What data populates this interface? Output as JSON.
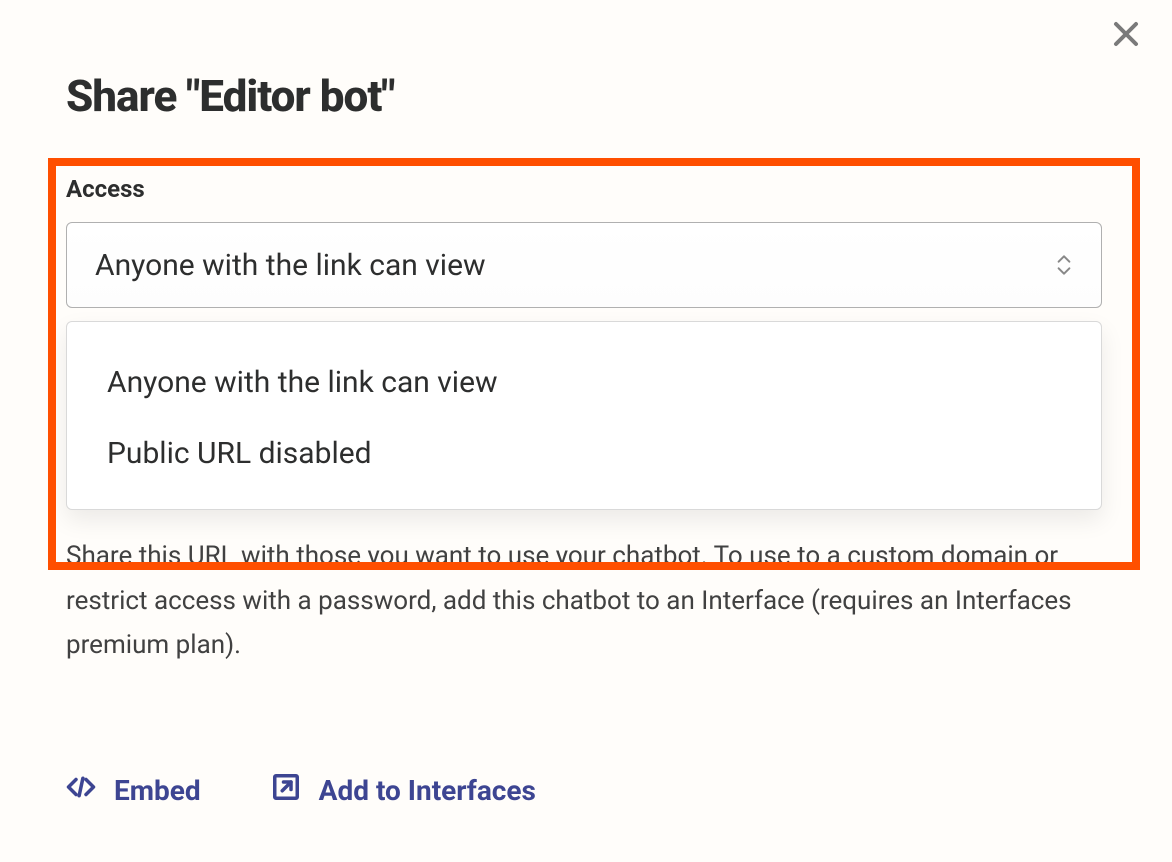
{
  "dialog": {
    "title": "Share \"Editor bot\""
  },
  "access": {
    "label": "Access",
    "selected": "Anyone with the link can view",
    "options": [
      "Anyone with the link can view",
      "Public URL disabled"
    ]
  },
  "help_text": "Share this URL with those you want to use your chatbot. To use to a custom domain or restrict access with a password, add this chatbot to an Interface (requires an Interfaces premium plan).",
  "actions": {
    "embed": "Embed",
    "add_to_interfaces": "Add to Interfaces"
  },
  "colors": {
    "highlight": "#ff4f00",
    "link": "#3d4592"
  }
}
